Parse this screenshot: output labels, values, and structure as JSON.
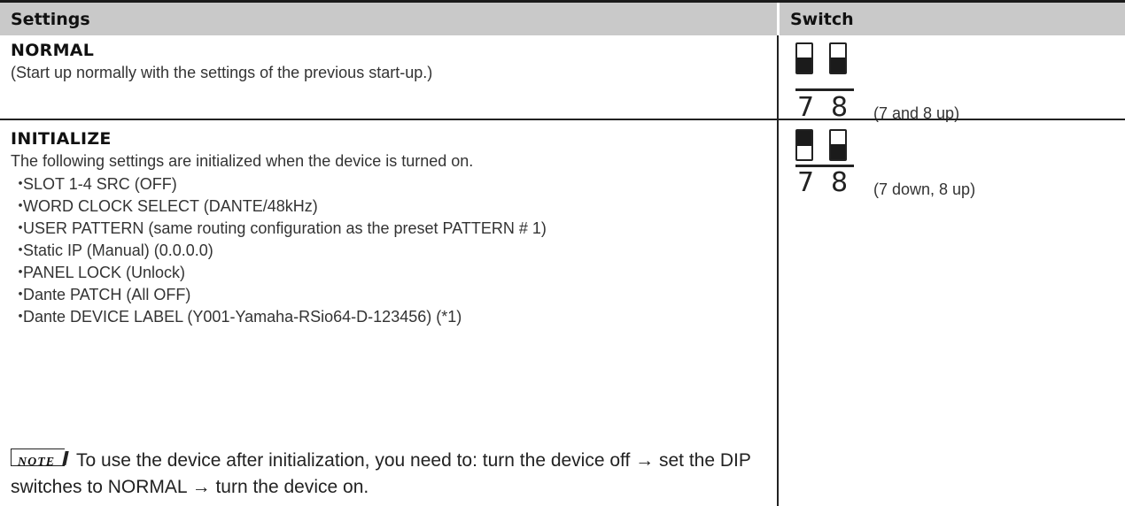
{
  "header": {
    "settings_label": "Settings",
    "switch_label": "Switch"
  },
  "rows": [
    {
      "title": "NORMAL",
      "description": "(Start up normally with the settings of the previous start-up.)",
      "switch": {
        "labels": [
          "7",
          "8"
        ],
        "positions": [
          "up",
          "up"
        ],
        "caption": "(7 and 8 up)"
      }
    },
    {
      "title": "INITIALIZE",
      "description": "The following settings are initialized when the device is turned on.",
      "bullets": [
        "SLOT 1-4 SRC (OFF)",
        "WORD CLOCK SELECT (DANTE/48kHz)",
        "USER PATTERN (same routing configuration as the preset PATTERN # 1)",
        "Static IP (Manual) (0.0.0.0)",
        "PANEL LOCK (Unlock)",
        "Dante PATCH (All OFF)",
        "Dante DEVICE LABEL (Y001-Yamaha-RSio64-D-123456) (*1)"
      ],
      "note": {
        "badge": "NOTE",
        "text": "To use the device after initialization, you need to: turn the device off → set the DIP switches to NORMAL → turn the device on."
      },
      "switch": {
        "labels": [
          "7",
          "8"
        ],
        "positions": [
          "down",
          "up"
        ],
        "caption": "(7 down, 8 up)"
      }
    }
  ]
}
